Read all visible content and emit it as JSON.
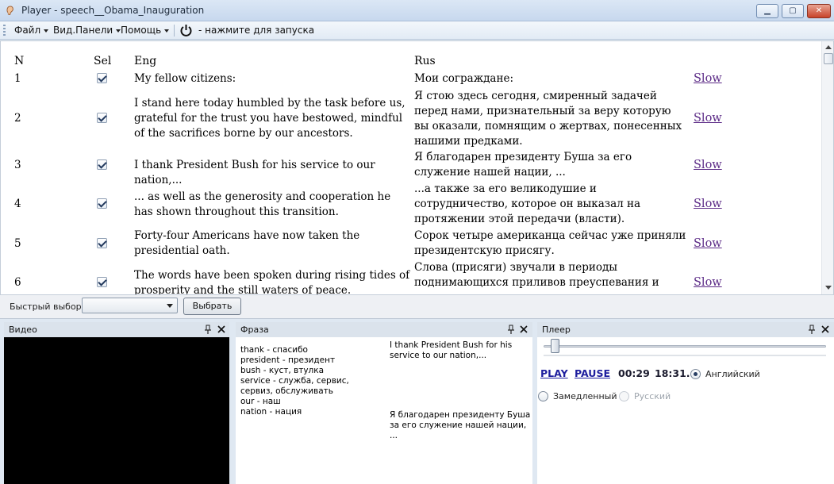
{
  "window": {
    "title": "Player - speech__Obama_Inauguration"
  },
  "menu": {
    "items": [
      {
        "label": "Файл"
      },
      {
        "label": "Вид.Панели"
      },
      {
        "label": "Помощь"
      }
    ],
    "start_hint": "- нажмите для запуска"
  },
  "grid": {
    "headers": {
      "n": "N",
      "sel": "Sel",
      "eng": "Eng",
      "rus": "Rus"
    },
    "rows": [
      {
        "n": "1",
        "selected": true,
        "eng": "My fellow citizens:",
        "rus": "Мои сограждане:",
        "slow": "Slow"
      },
      {
        "n": "2",
        "selected": true,
        "eng": "I stand here today humbled by the task before us, grateful for the trust you have bestowed, mindful of the sacrifices borne by our ancestors.",
        "rus": "Я стою здесь сегодня, смиренный задачей перед нами, признательный за веру которую вы оказали, помнящим о жертвах, понесенных нашими предками.",
        "slow": "Slow"
      },
      {
        "n": "3",
        "selected": true,
        "eng": "I thank President Bush for his service to our nation,...",
        "rus": "Я благодарен президенту Буша за его служение нашей нации, ...",
        "slow": "Slow"
      },
      {
        "n": "4",
        "selected": true,
        "eng": "... as well as the generosity and cooperation he has shown throughout this transition.",
        "rus": "...а также за его великодушие и сотрудничество, которое он выказал на протяжении этой передачи (власти).",
        "slow": "Slow"
      },
      {
        "n": "5",
        "selected": true,
        "eng": "Forty-four Americans have now taken the presidential oath.",
        "rus": "Сорок четыре американца сейчас уже приняли президентскую присягу.",
        "slow": "Slow"
      },
      {
        "n": "6",
        "selected": true,
        "eng": "The words have been spoken during rising tides of prosperity and the still waters of peace.",
        "rus": "Слова (присяги) звучали в периоды поднимающихся приливов преуспевания и",
        "slow": "Slow"
      }
    ]
  },
  "quick": {
    "label": "Быстрый выбор",
    "select_value": "",
    "button": "Выбрать"
  },
  "panels": {
    "video": {
      "title": "Видео"
    },
    "phrase": {
      "title": "Фраза",
      "dictionary": [
        "thank - спасибо",
        "president - президент",
        "bush - куст, втулка",
        "service - служба, сервис, сервиз, обслуживать",
        "our - наш",
        "nation - нация"
      ],
      "english": "I thank President Bush for his service to our nation,...",
      "russian": "Я благодарен президенту Буша за его служение нашей нации, ..."
    },
    "player": {
      "title": "Плеер",
      "play": "PLAY",
      "pause": "PAUSE",
      "time_current": "00:29",
      "time_total": "18:31.",
      "position_fraction": 0.026,
      "options": [
        {
          "label": "Английский",
          "checked": true,
          "enabled": true
        },
        {
          "label": "Замедленный",
          "checked": false,
          "enabled": true
        },
        {
          "label": "Русский",
          "checked": false,
          "enabled": false
        }
      ]
    }
  }
}
